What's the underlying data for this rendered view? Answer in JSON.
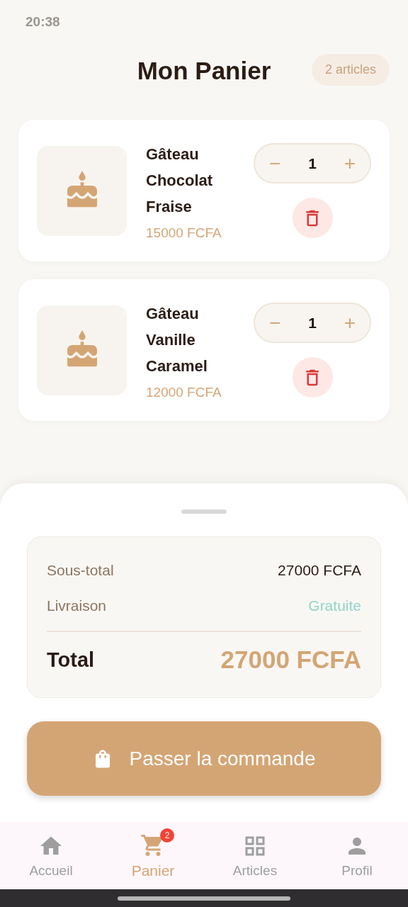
{
  "status_bar": {
    "time": "20:38"
  },
  "header": {
    "title": "Mon Panier",
    "count_badge": "2 articles"
  },
  "cart_items": [
    {
      "name": "Gâteau Chocolat Fraise",
      "price": "15000 FCFA",
      "quantity": "1",
      "minus": "−",
      "plus": "+"
    },
    {
      "name": "Gâteau Vanille Caramel",
      "price": "12000 FCFA",
      "quantity": "1",
      "minus": "−",
      "plus": "+"
    }
  ],
  "summary": {
    "rows": [
      {
        "label": "Sous-total",
        "value": "27000 FCFA",
        "kind": "plain"
      },
      {
        "label": "Livraison",
        "value": "Gratuite",
        "kind": "free"
      }
    ],
    "total_label": "Total",
    "total_value": "27000 FCFA"
  },
  "checkout_button": "Passer la commande",
  "bottom_nav": [
    {
      "label": "Accueil",
      "kind": "home",
      "selected": false
    },
    {
      "label": "Panier",
      "kind": "cart",
      "selected": true,
      "badge": "2"
    },
    {
      "label": "Articles",
      "kind": "grid",
      "selected": false
    },
    {
      "label": "Profil",
      "kind": "person",
      "selected": false
    }
  ]
}
